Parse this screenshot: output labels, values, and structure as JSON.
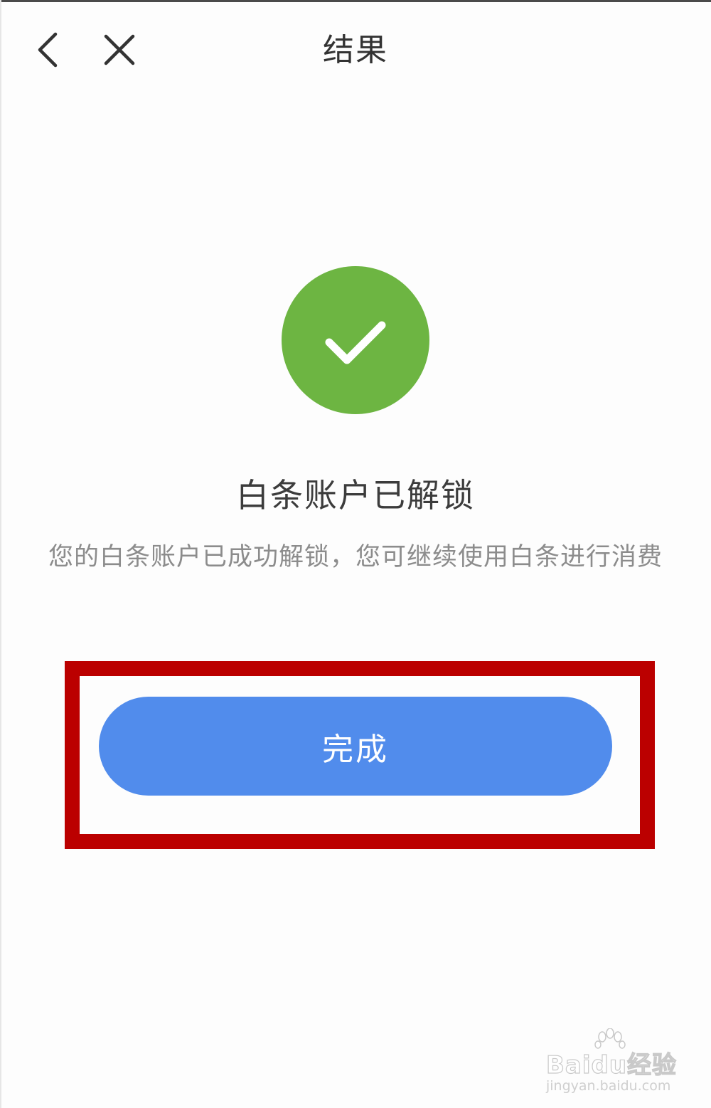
{
  "header": {
    "title": "结果",
    "back_icon": "chevron-left-icon",
    "close_icon": "close-icon"
  },
  "result": {
    "status_icon": "checkmark-circle-icon",
    "status_color": "#6db542",
    "heading": "白条账户已解锁",
    "description": "您的白条账户已成功解锁，您可继续使用白条进行消费"
  },
  "actions": {
    "done_label": "完成",
    "done_color": "#518cec",
    "highlight_color": "#bb0000"
  },
  "watermark": {
    "brand": "Baidu经验",
    "url": "jingyan.baidu.com"
  }
}
